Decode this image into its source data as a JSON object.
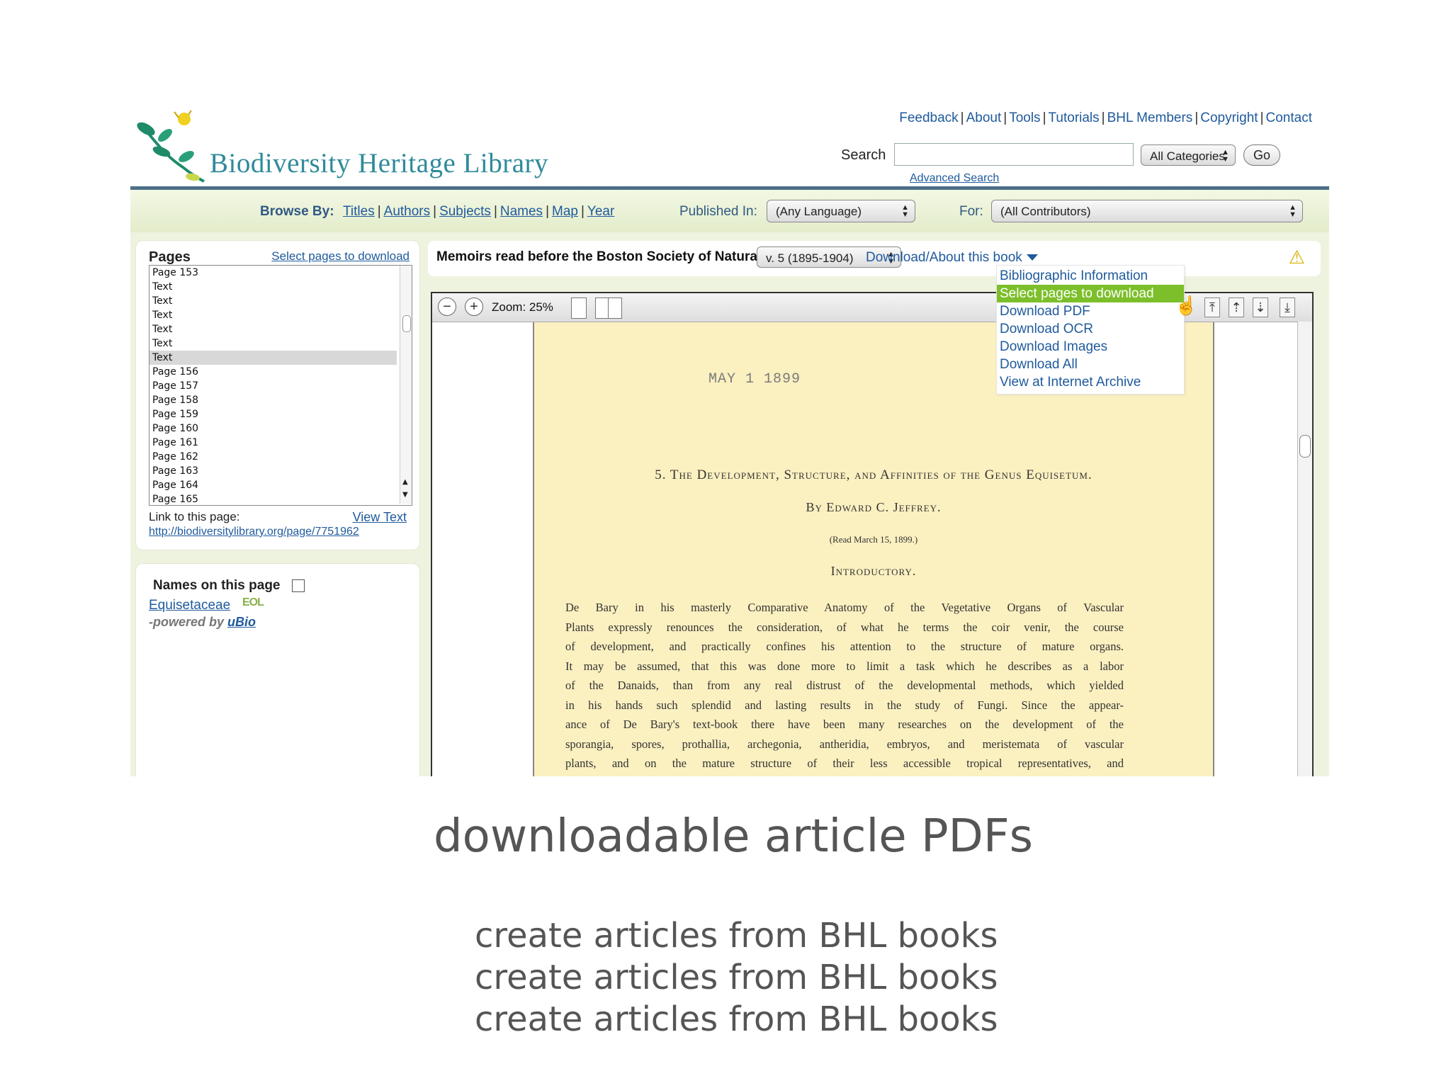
{
  "site": {
    "logo_text": "Biodiversity Heritage Library",
    "top_links": [
      "Feedback",
      "About",
      "Tools",
      "Tutorials",
      "BHL Members",
      "Copyright",
      "Contact"
    ],
    "search_label": "Search",
    "search_value": "",
    "category_select": "All Categories",
    "go_label": "Go",
    "advanced_search": "Advanced Search"
  },
  "browse": {
    "label": "Browse By:",
    "links": [
      "Titles",
      "Authors",
      "Subjects",
      "Names",
      "Map",
      "Year"
    ],
    "published_label": "Published In:",
    "language_select": "(Any Language)",
    "for_label": "For:",
    "contributor_select": "(All Contributors)"
  },
  "pages_panel": {
    "title": "Pages",
    "select_link": "Select pages to download",
    "items": [
      "Page 153",
      "Text",
      "Text",
      "Text",
      "Text",
      "Text",
      "Text",
      "Page 156",
      "Page 157",
      "Page 158",
      "Page 159",
      "Page 160",
      "Page 161",
      "Page 162",
      "Page 163",
      "Page 164",
      "Page 165"
    ],
    "selected_index": 6,
    "link_label": "Link to this page:",
    "view_text": "View Text",
    "page_url": "http://biodiversitylibrary.org/page/7751962"
  },
  "names_panel": {
    "title": "Names on this page",
    "name": "Equisetaceae",
    "eol_icon_text": "EOL",
    "powered_by": "-powered by",
    "powered_link": "uBio"
  },
  "book": {
    "title": "Memoirs read before the Boston Society of Natural History.",
    "volume_select": "v. 5 (1895-1904)",
    "download_menu_title": "Download/About this book",
    "warning_icon": "warning-icon"
  },
  "download_menu": {
    "items": [
      "Bibliographic Information",
      "Select pages to download",
      "Download PDF",
      "Download OCR",
      "Download Images",
      "Download All",
      "View at Internet Archive"
    ],
    "highlighted_index": 1
  },
  "viewer": {
    "zoom_label": "Zoom: 25%",
    "zoom_out": "−",
    "zoom_in": "+",
    "nav_first": "⤒",
    "nav_prev": "⇡",
    "nav_next": "⇣",
    "nav_last": "⤓"
  },
  "book_page": {
    "stamp": "MAY  1  1899",
    "article_title": "5. The Development, Structure, and Affinities of the Genus Equisetum.",
    "author": "By Edward C. Jeffrey.",
    "read_date": "(Read March 15, 1899.)",
    "section_heading": "Introductory.",
    "body_lines": [
      "De Bary in his masterly Comparative Anatomy of the Vegetative Organs of Vascular",
      "Plants expressly renounces the consideration, of what he terms the coir venir, the course",
      "of development, and practically confines his attention to the structure of mature organs.",
      "It may be assumed, that this was done more to limit a task which he describes as a labor",
      "of the Danaids, than from any real distrust of the developmental methods, which yielded",
      "in his hands such splendid and lasting results in the study of Fungi.  Since the appear-",
      "ance of De Bary's text-book there have been many researches on the development of the",
      "sporangia, spores, prothallia, archegonia, antheridia, embryos, and meristemata of vascular",
      "plants, and on the mature structure of their less accessible tropical representatives, and"
    ]
  },
  "slide": {
    "caption": "downloadable article PDFs",
    "lines": [
      "create articles from BHL books",
      "create articles from BHL books",
      "create articles from BHL books"
    ]
  },
  "colors": {
    "link": "#1f5a9c",
    "menu_highlight": "#7cbf2a",
    "page_paper": "#fbf0c0",
    "header_rule": "#4d6f86"
  }
}
